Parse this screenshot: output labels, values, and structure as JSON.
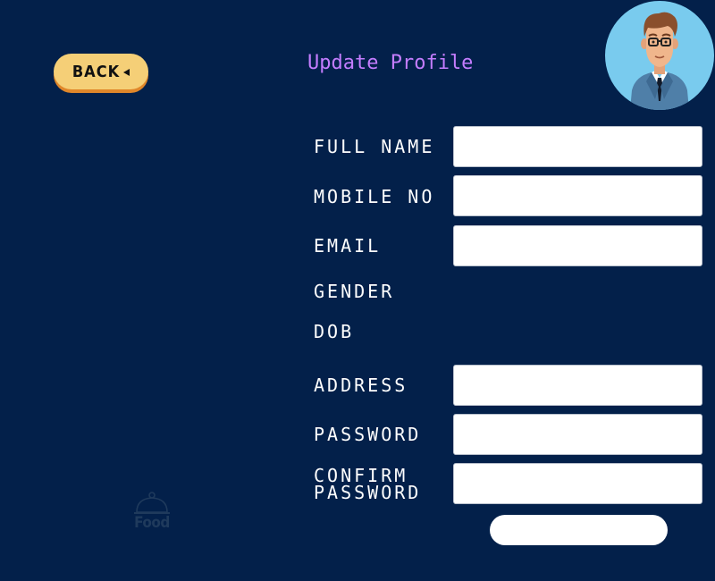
{
  "header": {
    "back_label": "BACK",
    "title": "Update Profile",
    "avatar_icon": "user-avatar"
  },
  "form": {
    "full_name_label": "FULL NAME",
    "full_name_value": "",
    "mobile_label": "MOBILE NO",
    "mobile_value": "",
    "email_label": "EMAIL",
    "email_value": "",
    "gender_label": "GENDER",
    "dob_label": "DOB",
    "address_label": "ADDRESS",
    "address_value": "",
    "password_label": "PASSWORD",
    "password_value": "",
    "confirm_password_label": "CONFIRM PASSWORD",
    "confirm_password_value": "",
    "submit_label": ""
  },
  "logo": {
    "text": "Food",
    "icon": "cloche-icon"
  },
  "colors": {
    "background": "#03204a",
    "accent_title": "#c47dff",
    "back_button": "#f5cf77",
    "back_button_shadow": "#e0872a",
    "avatar_bg": "#79cbee",
    "logo": "#1f3a5c"
  }
}
